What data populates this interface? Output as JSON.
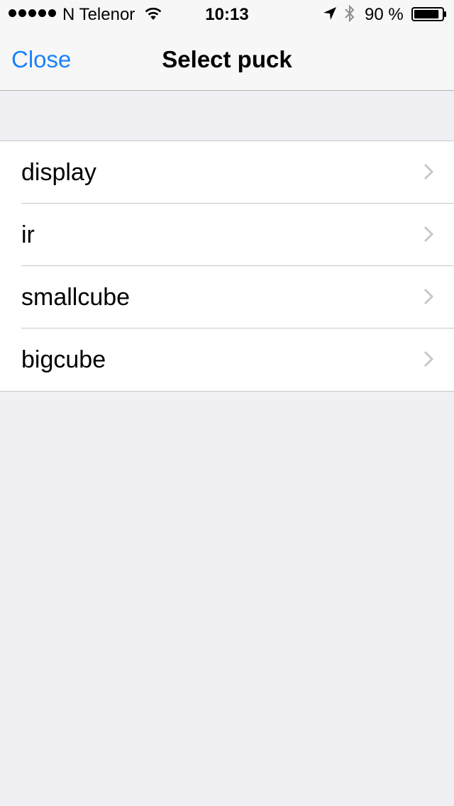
{
  "status_bar": {
    "carrier": "N Telenor",
    "time": "10:13",
    "battery_percent": "90 %",
    "battery_level": 0.9,
    "signal_bars": 5,
    "icons": [
      "signal-dots-icon",
      "wifi-icon",
      "location-arrow-icon",
      "bluetooth-icon",
      "battery-icon"
    ]
  },
  "nav": {
    "close_label": "Close",
    "title": "Select puck"
  },
  "list": {
    "items": [
      {
        "label": "display"
      },
      {
        "label": "ir"
      },
      {
        "label": "smallcube"
      },
      {
        "label": "bigcube"
      }
    ]
  },
  "colors": {
    "accent": "#1a82fb",
    "background": "#efeff4",
    "chevron": "#c7c7cc"
  }
}
